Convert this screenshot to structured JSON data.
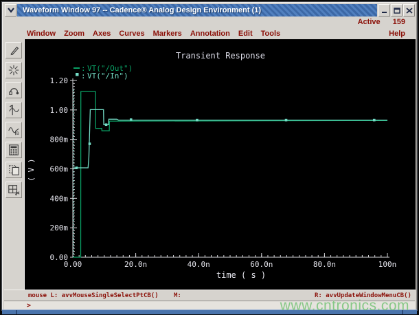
{
  "window": {
    "title": "Waveform Window 97 -- Cadence® Analog Design Environment (1)"
  },
  "active_row": {
    "label": "Active",
    "value": "159"
  },
  "menu": {
    "items": [
      "Window",
      "Zoom",
      "Axes",
      "Curves",
      "Markers",
      "Annotation",
      "Edit",
      "Tools"
    ],
    "help": "Help"
  },
  "toolbar": {
    "icons": [
      "pen-icon",
      "starburst-icon",
      "arc-probe-icon",
      "vertical-marker-icon",
      "waveform-b-icon",
      "calculator-icon",
      "duplicate-window-icon",
      "split-window-icon"
    ]
  },
  "statusbar": {
    "mouse_left": "mouse L: avvMouseSingleSelectPtCB()",
    "mouse_middle": "M:",
    "mouse_right": "R: avvUpdateWindowMenuCB()",
    "prompt": ">"
  },
  "watermark": "www.cntronics.com",
  "chart_data": {
    "type": "line",
    "title": "Transient Response",
    "xlabel": "time ( s )",
    "ylabel": "( V )",
    "x_unit": "ns",
    "xlim": [
      0,
      100
    ],
    "ylim": [
      0,
      1.2
    ],
    "grid": false,
    "background": "#000000",
    "colors": {
      "axis": "#d8d8dc",
      "text": "#e6e6ee",
      "title": "#dcdce8"
    },
    "x_ticks": [
      {
        "value": 0,
        "label": "0.00"
      },
      {
        "value": 20,
        "label": "20.0n"
      },
      {
        "value": 40,
        "label": "40.0n"
      },
      {
        "value": 60,
        "label": "60.0n"
      },
      {
        "value": 80,
        "label": "80.0n"
      },
      {
        "value": 100,
        "label": "100n"
      }
    ],
    "y_ticks": [
      {
        "value": 0.0,
        "label": "0.00"
      },
      {
        "value": 0.2,
        "label": "200m"
      },
      {
        "value": 0.4,
        "label": "400m"
      },
      {
        "value": 0.6,
        "label": "600m"
      },
      {
        "value": 0.8,
        "label": "800m"
      },
      {
        "value": 1.0,
        "label": "1.00"
      },
      {
        "value": 1.2,
        "label": "1.20"
      }
    ],
    "x_minor_step": 2,
    "y_minor_step": 0.02,
    "legend": {
      "colon": ":",
      "position": "top-left"
    },
    "series": [
      {
        "name": "VT(\"/Out\")",
        "color": "#0aa065",
        "marker": "dash",
        "points": [
          [
            0,
            0
          ],
          [
            2.5,
            0
          ],
          [
            2.55,
            1.125
          ],
          [
            7.2,
            1.125
          ],
          [
            7.25,
            0.875
          ],
          [
            9.2,
            0.875
          ],
          [
            9.25,
            0.858
          ],
          [
            11.6,
            0.858
          ],
          [
            11.65,
            0.924
          ],
          [
            100,
            0.928
          ]
        ]
      },
      {
        "name": "VT(\"/In\")",
        "color": "#74dcc6",
        "marker": "square",
        "points": [
          [
            0.25,
            0.607
          ],
          [
            4.85,
            0.607
          ],
          [
            5.1,
            0.68
          ],
          [
            5.55,
            1.002
          ],
          [
            9.75,
            1.002
          ],
          [
            9.85,
            0.9
          ],
          [
            11.35,
            0.9
          ],
          [
            11.45,
            0.937
          ],
          [
            14,
            0.937
          ],
          [
            14.5,
            0.931
          ],
          [
            100,
            0.931
          ]
        ],
        "marker_points": [
          [
            1.2,
            0.607
          ],
          [
            5.35,
            0.77
          ],
          [
            10.6,
            0.9
          ],
          [
            18.5,
            0.934
          ],
          [
            39.5,
            0.931
          ],
          [
            67.8,
            0.931
          ],
          [
            95.8,
            0.931
          ]
        ],
        "startup_spike": {
          "t": 0.25,
          "v_from": 0.0,
          "v_to": 1.14,
          "style": "dashed"
        }
      }
    ]
  }
}
